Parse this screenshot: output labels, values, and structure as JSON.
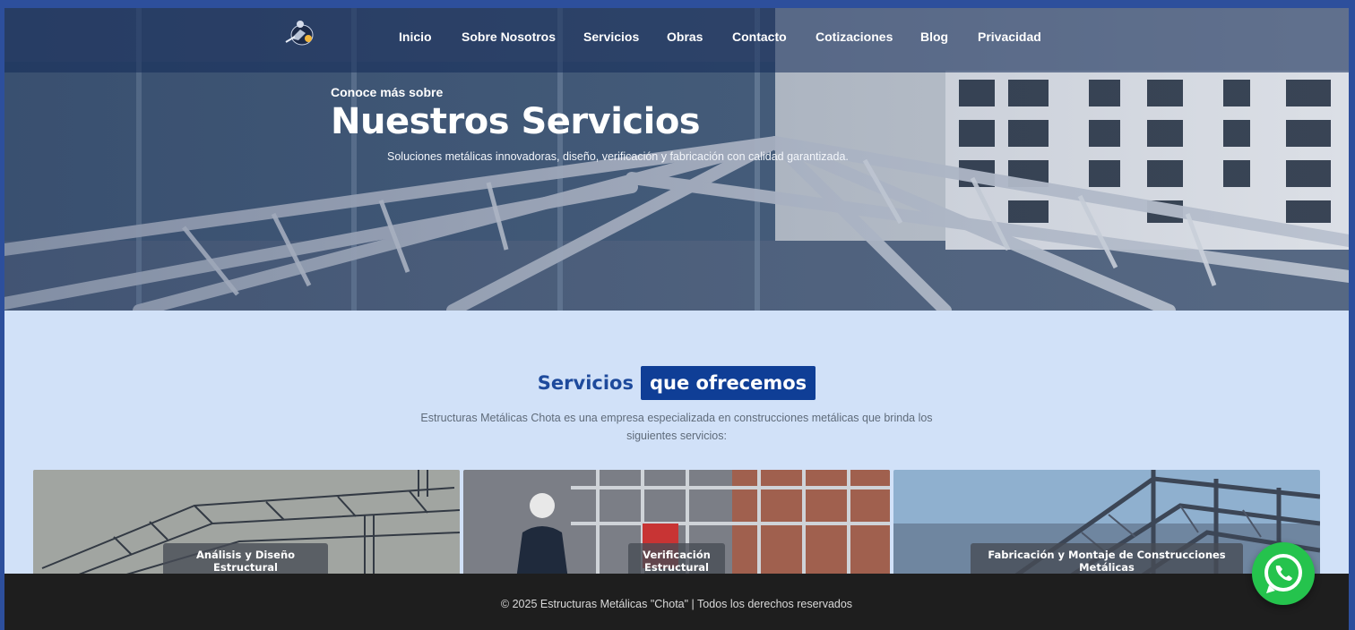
{
  "nav": {
    "items": [
      {
        "label": "Inicio"
      },
      {
        "label": "Sobre Nosotros"
      },
      {
        "label": "Servicios"
      },
      {
        "label": "Obras"
      },
      {
        "label": "Contacto"
      },
      {
        "label": "Cotizaciones"
      },
      {
        "label": "Blog"
      },
      {
        "label": "Privacidad"
      }
    ]
  },
  "hero": {
    "pretitle": "Conoce más sobre",
    "title": "Nuestros Servicios",
    "subtitle": "Soluciones metálicas innovadoras, diseño, verificación y fabricación con calidad garantizada."
  },
  "services": {
    "heading_plain": "Servicios",
    "heading_highlight": "que ofrecemos",
    "description": "Estructuras Metálicas Chota es una empresa especializada en construcciones metálicas que brinda los siguientes servicios:",
    "cards": [
      {
        "label": "Análisis y Diseño Estructural"
      },
      {
        "label": "Verificación Estructural"
      },
      {
        "label": "Fabricación y Montaje de Construcciones Metálicas"
      }
    ]
  },
  "footer": {
    "text": "© 2025 Estructuras Metálicas \"Chota\" | Todos los derechos reservados"
  },
  "icons": {
    "logo": "welder-logo-icon",
    "whatsapp": "whatsapp-icon"
  },
  "colors": {
    "brand_blue": "#0f3e96",
    "heading_blue": "#1e4a9c",
    "section_bg": "#d1e1f8",
    "footer_bg": "#1e1e1e",
    "whatsapp_green": "#25c34d"
  }
}
